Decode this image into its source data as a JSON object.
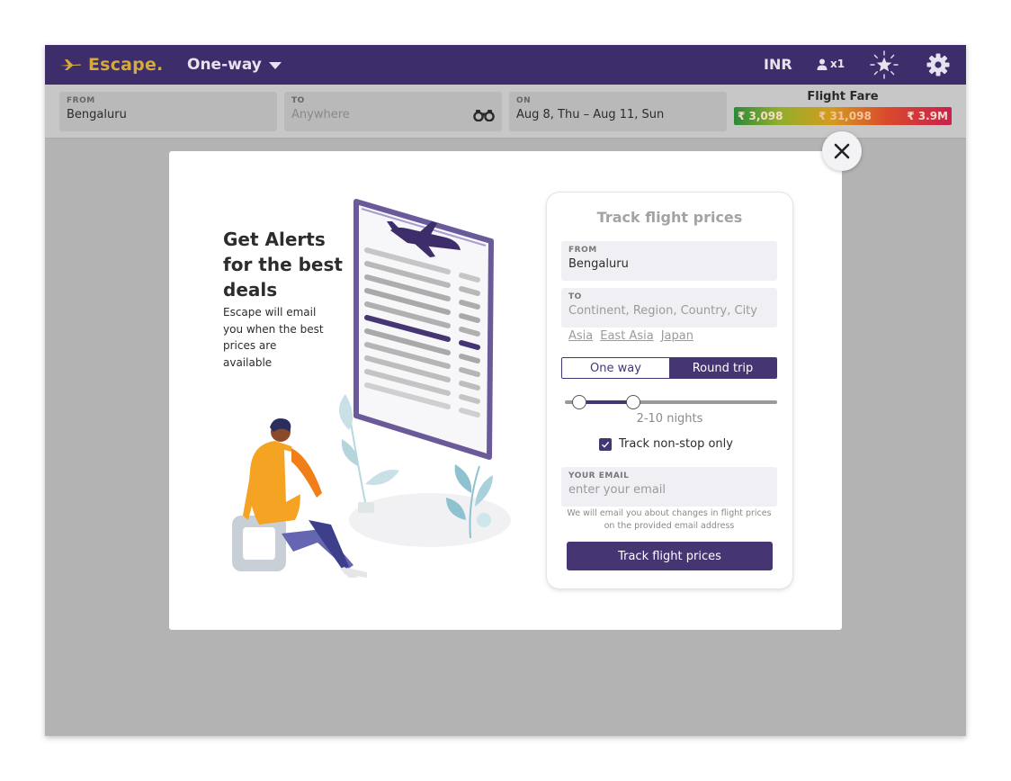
{
  "header": {
    "logo_text": "Escape.",
    "trip_type": "One-way",
    "currency": "INR",
    "passengers": "x1"
  },
  "search": {
    "from_label": "FROM",
    "from_value": "Bengaluru",
    "to_label": "TO",
    "to_placeholder": "Anywhere",
    "on_label": "ON",
    "on_value": "Aug 8, Thu – Aug 11, Sun",
    "fare_title": "Flight Fare",
    "fare_low": "₹ 3,098",
    "fare_mid": "₹ 31,098",
    "fare_high": "₹ 3.9M"
  },
  "promo": {
    "title": "Get Alerts for the best deals",
    "description": "Escape will email you when the best prices are available"
  },
  "track": {
    "title": "Track flight prices",
    "from_label": "FROM",
    "from_value": "Bengaluru",
    "to_label": "TO",
    "to_placeholder": "Continent, Region, Country, City",
    "suggestions": [
      "Asia",
      "East Asia",
      "Japan"
    ],
    "one_way": "One way",
    "round_trip": "Round trip",
    "selected_trip": "Round trip",
    "nights_min": 2,
    "nights_max": 10,
    "range_min": 1,
    "range_max": 30,
    "nights_label": "2-10 nights",
    "nonstop_label": "Track non-stop only",
    "nonstop_checked": true,
    "email_label": "YOUR EMAIL",
    "email_placeholder": "enter your email",
    "note": "We will email you about changes in flight prices on the provided email address",
    "button": "Track flight prices"
  },
  "colors": {
    "brand_purple": "#3e2d6b",
    "accent_purple": "#463573",
    "logo_gold": "#d4a93e"
  },
  "icons": [
    "plane-icon",
    "chevron-down-icon",
    "person-icon",
    "star-icon",
    "gear-icon",
    "binoculars-icon",
    "close-icon",
    "check-icon"
  ]
}
